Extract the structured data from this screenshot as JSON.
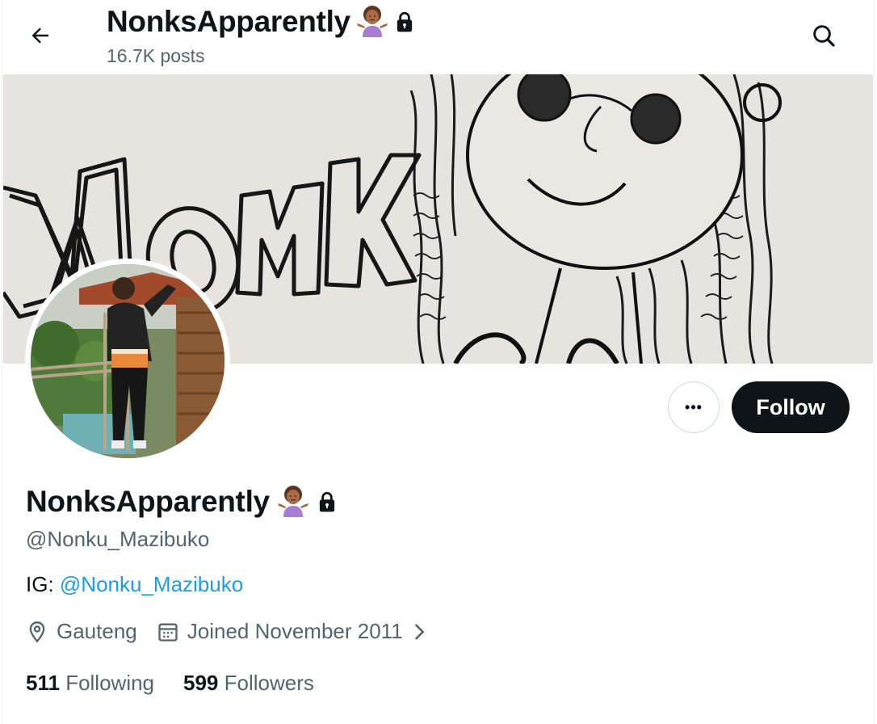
{
  "header": {
    "display_name": "NonksApparently",
    "posts_count": "16.7K posts",
    "back_icon": "arrow-left-icon",
    "search_icon": "search-icon",
    "emoji": "person-shrugging-emoji"
  },
  "profile": {
    "display_name": "NonksApparently",
    "handle": "@Nonku_Mazibuko",
    "bio_prefix": "IG: ",
    "bio_link": "@Nonku_Mazibuko",
    "location": "Gauteng",
    "joined": "Joined November 2011",
    "following_count": "511",
    "following_label": "Following",
    "followers_count": "599",
    "followers_label": "Followers",
    "protected_icon": "lock-icon"
  },
  "actions": {
    "more_label": "•••",
    "follow_label": "Follow"
  },
  "colors": {
    "text_primary": "#0f1419",
    "text_secondary": "#536471",
    "link": "#1d9bf0",
    "follow_bg": "#0f1419",
    "emoji_shirt": "#a67dd1",
    "emoji_skin": "#a86c47"
  }
}
